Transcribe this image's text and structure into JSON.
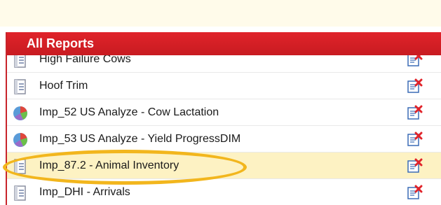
{
  "panel": {
    "title": "All Reports",
    "accent_color": "#c8242b",
    "highlight_color": "#fdf2c3",
    "annotation_color": "#f2b61d"
  },
  "reports": [
    {
      "label": "High Failure Cows",
      "icon": "report-doc-icon",
      "action_icon": "edit-delete-icon"
    },
    {
      "label": "Hoof Trim",
      "icon": "report-doc-icon",
      "action_icon": "edit-delete-icon"
    },
    {
      "label": "Imp_52 US Analyze - Cow Lactation",
      "icon": "pie-chart-icon",
      "action_icon": "edit-delete-icon"
    },
    {
      "label": "Imp_53 US Analyze - Yield ProgressDIM",
      "icon": "pie-chart-icon",
      "action_icon": "edit-delete-icon"
    },
    {
      "label": "Imp_87.2 - Animal Inventory",
      "icon": "report-doc-icon",
      "action_icon": "edit-delete-icon",
      "highlighted": true
    },
    {
      "label": "Imp_DHI - Arrivals",
      "icon": "report-doc-icon",
      "action_icon": "edit-delete-icon"
    }
  ]
}
